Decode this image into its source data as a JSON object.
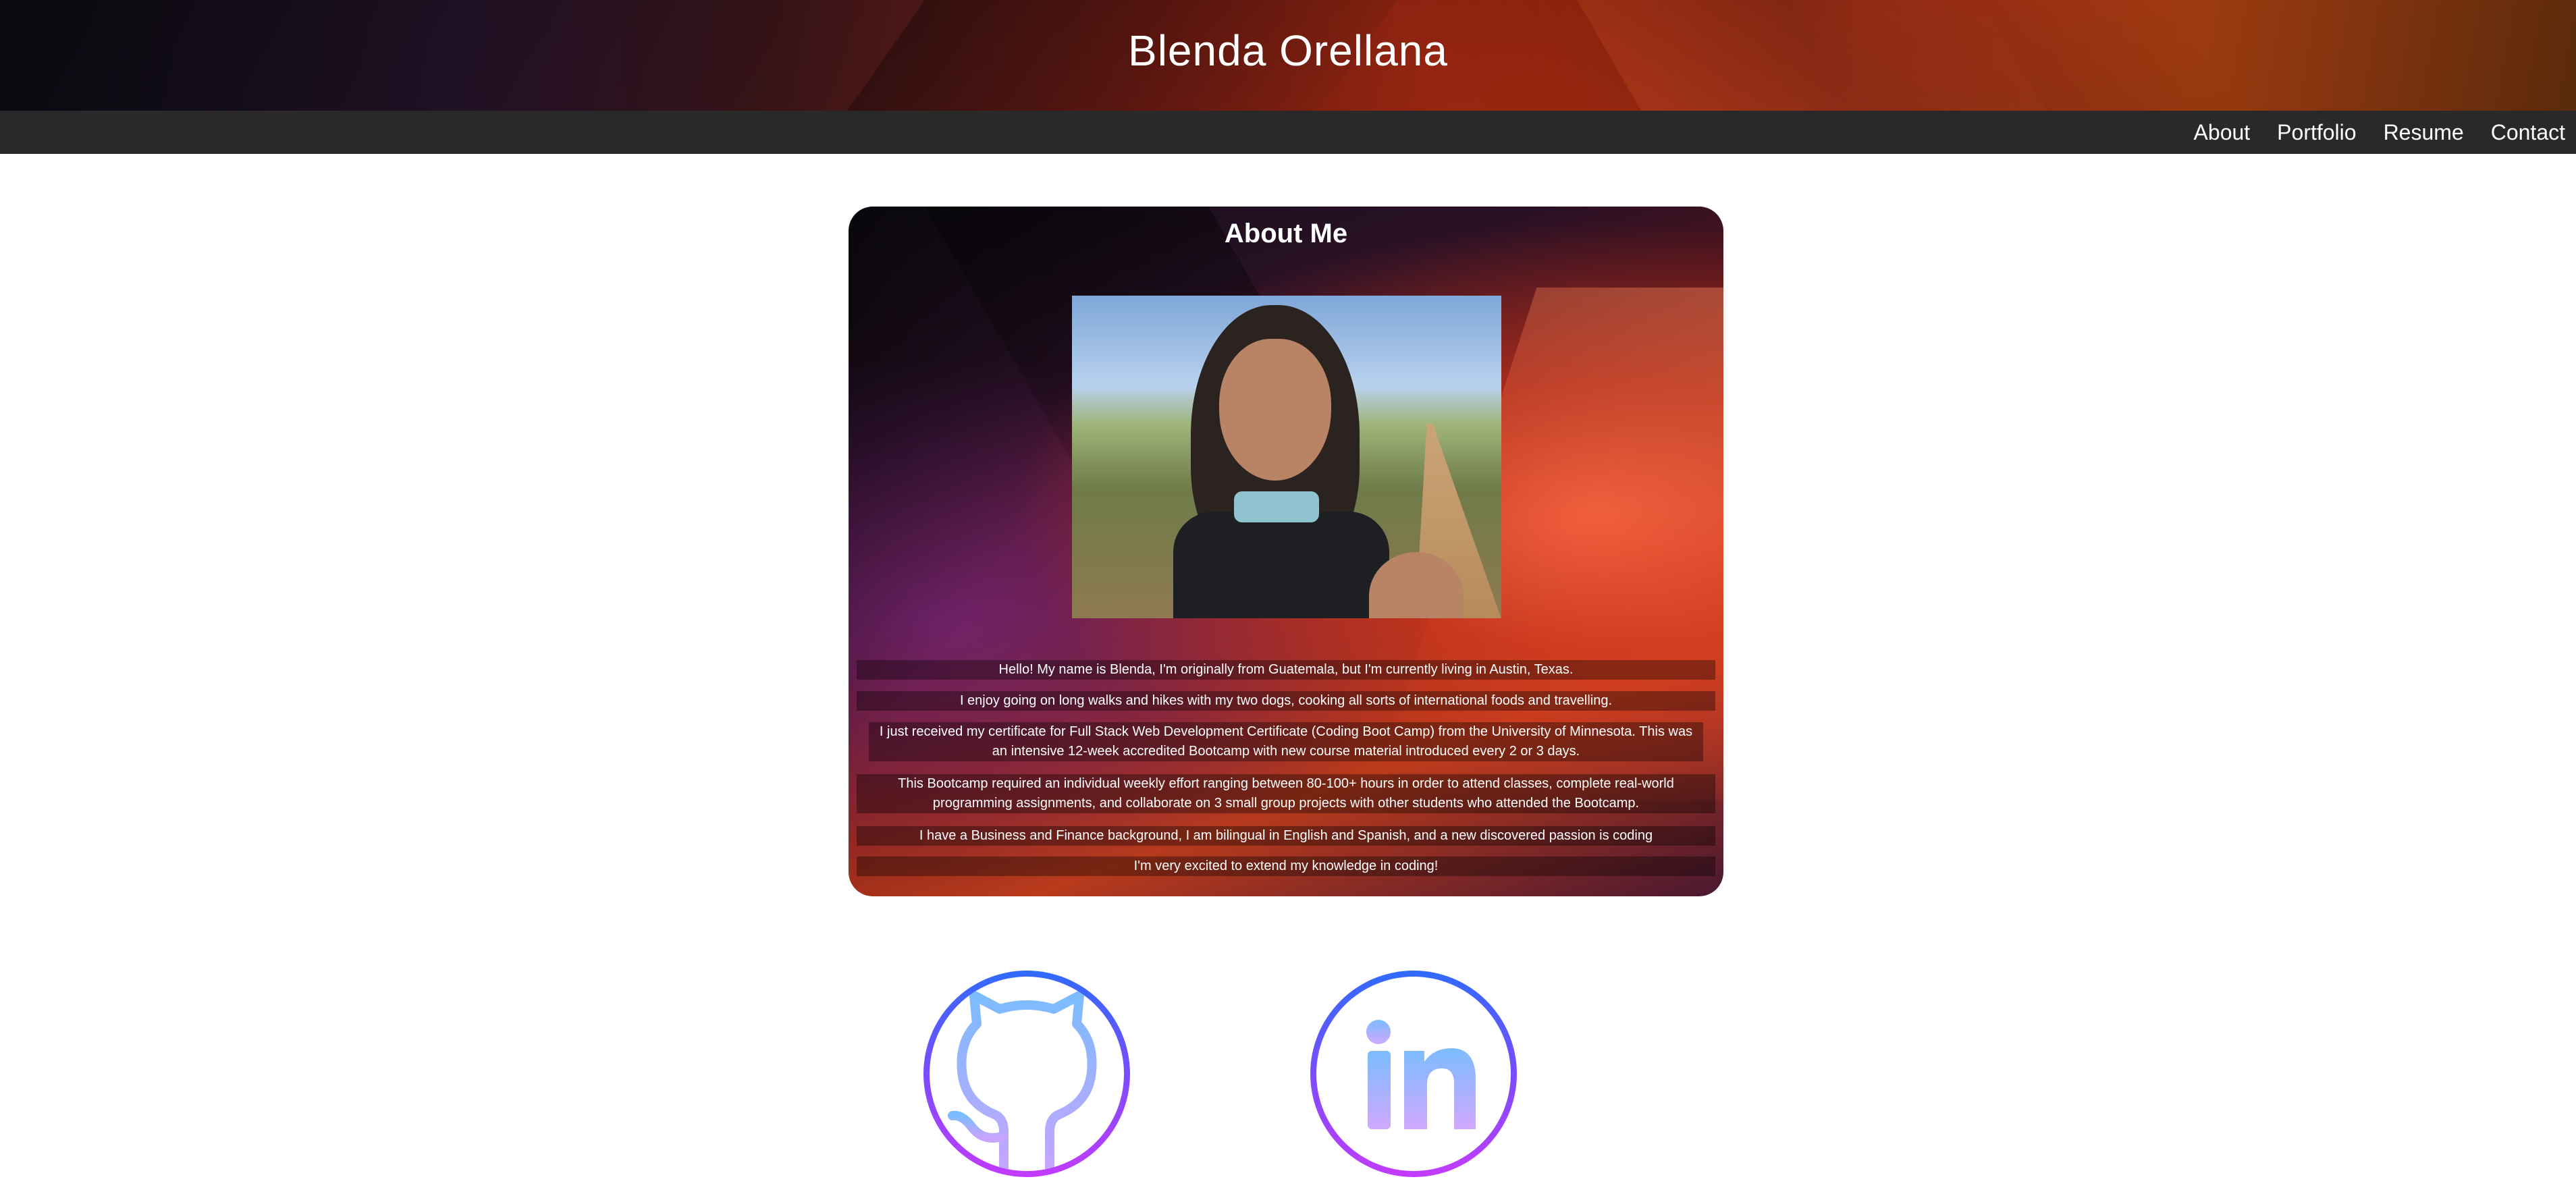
{
  "header": {
    "title": "Blenda Orellana"
  },
  "nav": {
    "items": [
      "About",
      "Portfolio",
      "Resume",
      "Contact"
    ]
  },
  "about": {
    "title": "About Me",
    "paragraphs": [
      "Hello! My name is Blenda, I'm originally from Guatemala, but I'm currently living in Austin, Texas.",
      "I enjoy going on long walks and hikes with my two dogs, cooking all sorts of international foods and travelling.",
      "I just received my certificate for Full Stack Web Development Certificate (Coding Boot Camp) from the University of Minnesota. This was an intensive 12-week accredited Bootcamp with new course material introduced every 2 or 3 days.",
      "This Bootcamp required an individual weekly effort ranging between 80-100+ hours in order to attend classes, complete real-world programming assignments, and collaborate on 3 small group projects with other students who attended the Bootcamp.",
      "I have a Business and Finance background, I am bilingual in English and Spanish, and a new discovered passion is coding",
      "I'm very excited to extend my knowledge in coding!"
    ]
  },
  "social": {
    "icons": [
      "github-icon",
      "linkedin-icon"
    ]
  },
  "colors": {
    "navbar": "#2a2929",
    "social_gradient_start": "#2f6bff",
    "social_gradient_end": "#c23bff"
  }
}
